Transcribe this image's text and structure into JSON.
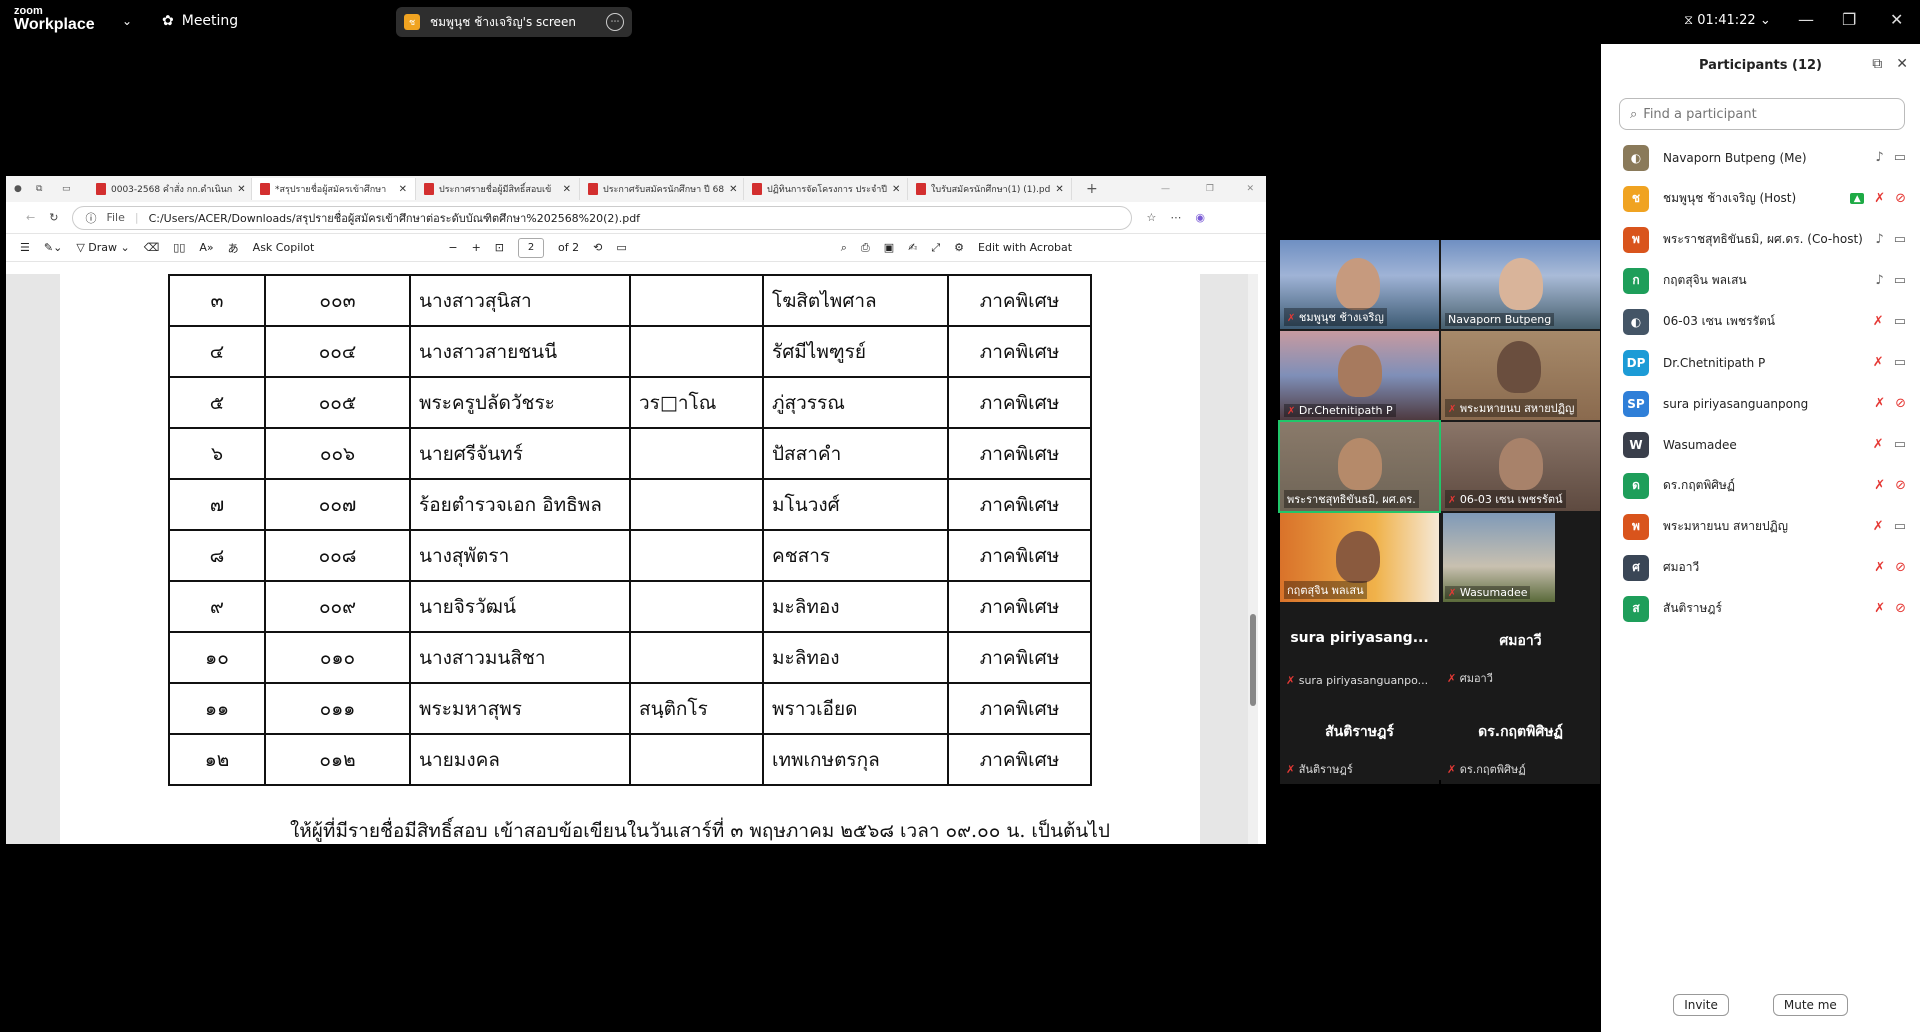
{
  "topbar": {
    "logo_line1": "zoom",
    "logo_line2": "Workplace",
    "meeting_label": "Meeting",
    "share_label": "ชมพูนุช ช้างเจริญ's screen",
    "share_badge": "ช",
    "timer": "01:41:22"
  },
  "acrobat": {
    "tabs": [
      {
        "label": "0003-2568 คำสั่ง กก.ดำเนินก"
      },
      {
        "label": "*สรุปรายชื่อผู้สมัครเข้าศึกษา"
      },
      {
        "label": "ประกาศรายชื่อผู้มีสิทธิ์สอบเข้"
      },
      {
        "label": "ประกาศรับสมัครนักศึกษา ปี 68"
      },
      {
        "label": "ปฏิทินการจัดโครงการ ประจำปี"
      },
      {
        "label": "ใบรับสมัครนักศึกษา(1) (1).pd"
      }
    ],
    "url_prefix": "File",
    "url": "C:/Users/ACER/Downloads/สรุปรายชื่อผู้สมัครเข้าศึกษาต่อระดับบัณฑิตศึกษา%202568%20(2).pdf",
    "toolbar": {
      "draw": "Draw",
      "ask_copilot": "Ask Copilot",
      "page_current": "2",
      "page_total": "of 2",
      "edit_acrobat": "Edit with Acrobat"
    },
    "table_rows": [
      {
        "no": "๓",
        "code": "๐๐๓",
        "name": "นางสาวสุนิสา",
        "title": "",
        "surname": "โฆสิตไพศาล",
        "program": "ภาคพิเศษ"
      },
      {
        "no": "๔",
        "code": "๐๐๔",
        "name": "นางสาวสายชนนี",
        "title": "",
        "surname": "รัศมีไพฑูรย์",
        "program": "ภาคพิเศษ"
      },
      {
        "no": "๕",
        "code": "๐๐๕",
        "name": "พระครูปลัดวัชระ",
        "title": "วร□าโณ",
        "surname": "ภู่สุวรรณ",
        "program": "ภาคพิเศษ"
      },
      {
        "no": "๖",
        "code": "๐๐๖",
        "name": "นายศรีจันทร์",
        "title": "",
        "surname": "ปัสสาคำ",
        "program": "ภาคพิเศษ"
      },
      {
        "no": "๗",
        "code": "๐๐๗",
        "name": "ร้อยตำรวจเอก อิทธิพล",
        "title": "",
        "surname": "มโนวงศ์",
        "program": "ภาคพิเศษ"
      },
      {
        "no": "๘",
        "code": "๐๐๘",
        "name": "นางสุพัตรา",
        "title": "",
        "surname": "คชสาร",
        "program": "ภาคพิเศษ"
      },
      {
        "no": "๙",
        "code": "๐๐๙",
        "name": "นายจิรวัฒน์",
        "title": "",
        "surname": "มะลิทอง",
        "program": "ภาคพิเศษ"
      },
      {
        "no": "๑๐",
        "code": "๐๑๐",
        "name": "นางสาวมนสิชา",
        "title": "",
        "surname": "มะลิทอง",
        "program": "ภาคพิเศษ"
      },
      {
        "no": "๑๑",
        "code": "๐๑๑",
        "name": "พระมหาสุพร",
        "title": "สนฺติกโร",
        "surname": "พราวเอียด",
        "program": "ภาคพิเศษ"
      },
      {
        "no": "๑๒",
        "code": "๐๑๒",
        "name": "นายมงคล",
        "title": "",
        "surname": "เทพเกษตรกุล",
        "program": "ภาคพิเศษ"
      }
    ],
    "footer_text": "ให้ผู้ที่มีรายชื่อมีสิทธิ์สอบ เข้าสอบข้อเขียนในวันเสาร์ที่ ๓ พฤษภาคม ๒๕๖๘ เวลา ๐๙.๐๐ น. เป็นต้นไป"
  },
  "gallery": {
    "tiles": [
      {
        "name": "ชมพูนุช ช้างเจริญ"
      },
      {
        "name": "Navaporn Butpeng"
      },
      {
        "name": "Dr.Chetnitipath P"
      },
      {
        "name": "พระมหายนบ สหายปฏิญ"
      },
      {
        "name": "พระราชสุทธิขันธมิ, ผศ.ดร."
      },
      {
        "name": "06-03 เซน เพชรรัตน์"
      },
      {
        "name": "กฤตสุจิน พลเสน"
      },
      {
        "name": "Wasumadee"
      }
    ],
    "blank_tiles": [
      {
        "big": "sura piriyasang...",
        "small": "sura piriyasanguanpo..."
      },
      {
        "big": "ศมอาวี",
        "small": "ศมอาวี"
      },
      {
        "big": "สันติราษฎร์",
        "small": "สันติราษฎร์"
      },
      {
        "big": "ดร.กฤตพิศิษฏ์",
        "small": "ดร.กฤตพิศิษฏ์"
      }
    ]
  },
  "participants": {
    "title": "Participants (12)",
    "search_placeholder": "Find a participant",
    "list": [
      {
        "name": "Navaporn Butpeng (Me)",
        "initial": "",
        "color": "#8a7a5a"
      },
      {
        "name": "ชมพูนุช ช้างเจริญ (Host)",
        "initial": "ช",
        "color": "#f0a321"
      },
      {
        "name": "พระราชสุทธิขันธมิ, ผศ.ดร. (Co-host)",
        "initial": "พ",
        "color": "#d9541c"
      },
      {
        "name": "กฤตสุจิน พลเสน",
        "initial": "ก",
        "color": "#1e9e5a"
      },
      {
        "name": "06-03 เซน เพชรรัตน์",
        "initial": "",
        "color": "#445566"
      },
      {
        "name": "Dr.Chetnitipath P",
        "initial": "DP",
        "color": "#1c9bd6"
      },
      {
        "name": "sura piriyasanguanpong",
        "initial": "SP",
        "color": "#2f7fd8"
      },
      {
        "name": "Wasumadee",
        "initial": "W",
        "color": "#3a3f4b"
      },
      {
        "name": "ดร.กฤตพิศิษฏ์",
        "initial": "ด",
        "color": "#1e9e5a"
      },
      {
        "name": "พระมหายนบ สหายปฏิญ",
        "initial": "พ",
        "color": "#d9541c"
      },
      {
        "name": "ศมอาวี",
        "initial": "ศ",
        "color": "#3a4656"
      },
      {
        "name": "สันติราษฎร์",
        "initial": "ส",
        "color": "#1e9e5a"
      }
    ],
    "invite_label": "Invite",
    "mute_label": "Mute me"
  }
}
